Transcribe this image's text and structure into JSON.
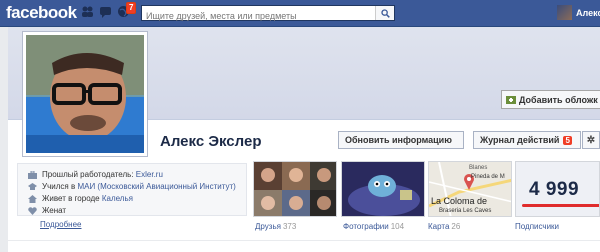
{
  "topbar": {
    "logo": "facebook",
    "notifications_count": "7",
    "search": {
      "placeholder": "Ищите друзей, места или предметы"
    },
    "user_short": "Алекс"
  },
  "cover": {
    "add_cover_label": "Добавить обложк"
  },
  "profile": {
    "name": "Алекс Экслер",
    "update_info_label": "Обновить информацию",
    "activity_log_label": "Журнал действий",
    "activity_badge": "5"
  },
  "about": {
    "employer_prefix": "Прошлый работодатель:",
    "employer": "Exler.ru",
    "study_prefix": "Учился в",
    "study": "МАИ (Московский Авиационный Институт)",
    "lives_prefix": "Живет в городе",
    "lives": "Калелья",
    "relationship": "Женат",
    "more_label": "Подробнее"
  },
  "tiles": {
    "friends": {
      "label": "Друзья",
      "count": "373"
    },
    "photos": {
      "label": "Фотографии",
      "count": "104"
    },
    "map": {
      "label": "Карта",
      "count": "26",
      "labels": [
        "Blanes",
        "Pineda de M",
        "La Coloma de",
        "Braseria Les Caves"
      ]
    },
    "subscribers": {
      "label": "Подписчики",
      "count": "",
      "value": "4 999"
    }
  },
  "colors": {
    "brand": "#3b5998",
    "badge": "#f03d25"
  }
}
